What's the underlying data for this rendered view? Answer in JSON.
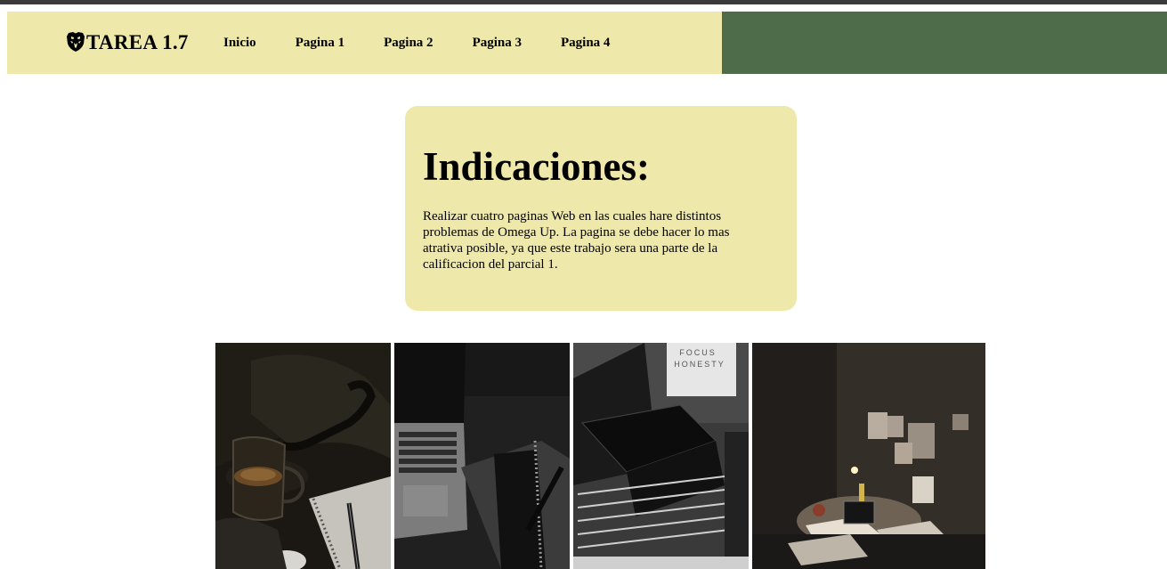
{
  "header": {
    "logo_text": "TAREA 1.7",
    "logo_icon": "lion-shield-icon",
    "colors": {
      "left": "#eee8aa",
      "right": "#4e6b4a"
    },
    "nav": [
      {
        "label": "Inicio"
      },
      {
        "label": "Pagina 1"
      },
      {
        "label": "Pagina 2"
      },
      {
        "label": "Pagina 3"
      },
      {
        "label": "Pagina 4"
      }
    ]
  },
  "card": {
    "title": "Indicaciones:",
    "body": "Realizar cuatro paginas Web en las cuales hare distintos problemas de Omega Up. La pagina se debe hacer lo mas atrativa posible, ya que este trabajo sera una parte de la calificacion del parcial 1."
  },
  "gallery": {
    "photos": [
      {
        "subject": "coffee-and-notebook-photo"
      },
      {
        "subject": "laptop-and-notebook-photo"
      },
      {
        "subject": "stacked-books-photo",
        "poster_text": [
          "FOCUS",
          "HONESTY"
        ]
      },
      {
        "subject": "desk-with-lamp-photo"
      }
    ]
  }
}
